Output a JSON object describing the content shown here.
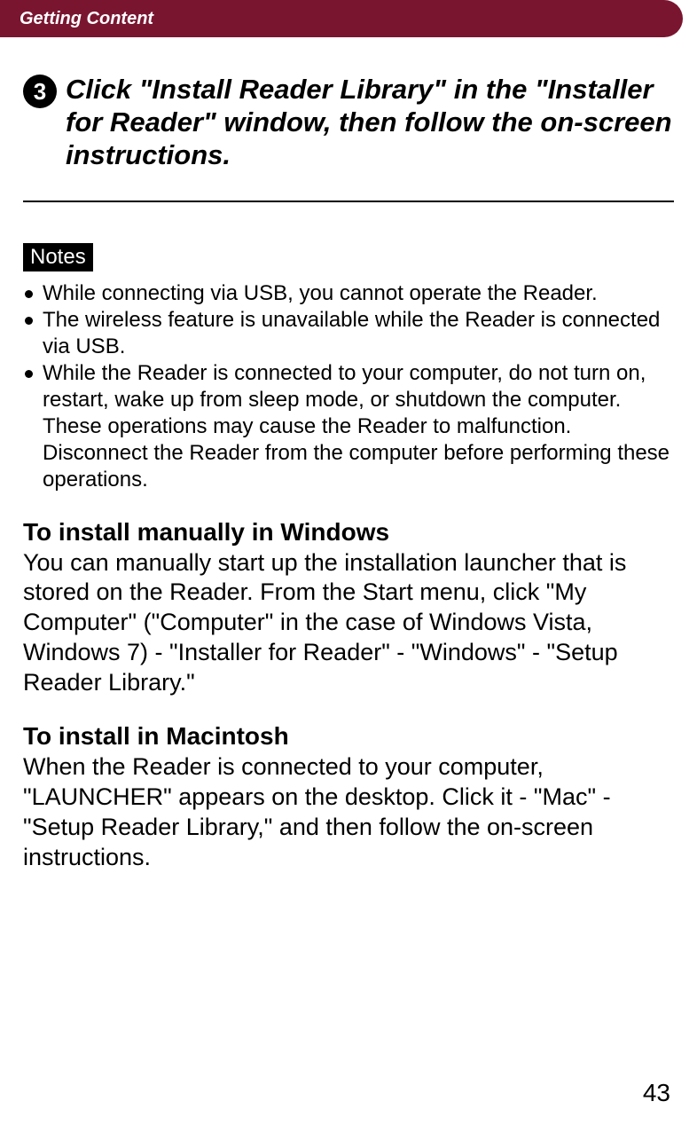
{
  "header": {
    "title": "Getting Content"
  },
  "step": {
    "number": "3",
    "text": "Click \"Install Reader Library\" in the \"Installer for Reader\" window, then follow the on-screen instructions."
  },
  "notes": {
    "label": "Notes",
    "items": [
      "While connecting via USB, you cannot operate the Reader.",
      "The wireless feature is unavailable while the Reader is connected via USB.",
      "While the Reader is connected to your computer, do not turn on, restart, wake up from sleep mode, or shutdown the computer. These operations may cause the Reader to malfunction. Disconnect the Reader from the computer before performing these operations."
    ]
  },
  "sections": [
    {
      "heading": "To install manually in Windows",
      "body": "You can manually start up the installation launcher that is stored on the Reader. From the Start menu, click \"My Computer\" (\"Computer\" in the case of Windows Vista, Windows 7) - \"Installer for Reader\" - \"Windows\" - \"Setup Reader Library.\""
    },
    {
      "heading": "To install in Macintosh",
      "body": "When the Reader is connected to your computer, \"LAUNCHER\" appears on the desktop. Click it - \"Mac\" - \"Setup Reader Library,\" and then follow the on-screen instructions."
    }
  ],
  "page_number": "43"
}
